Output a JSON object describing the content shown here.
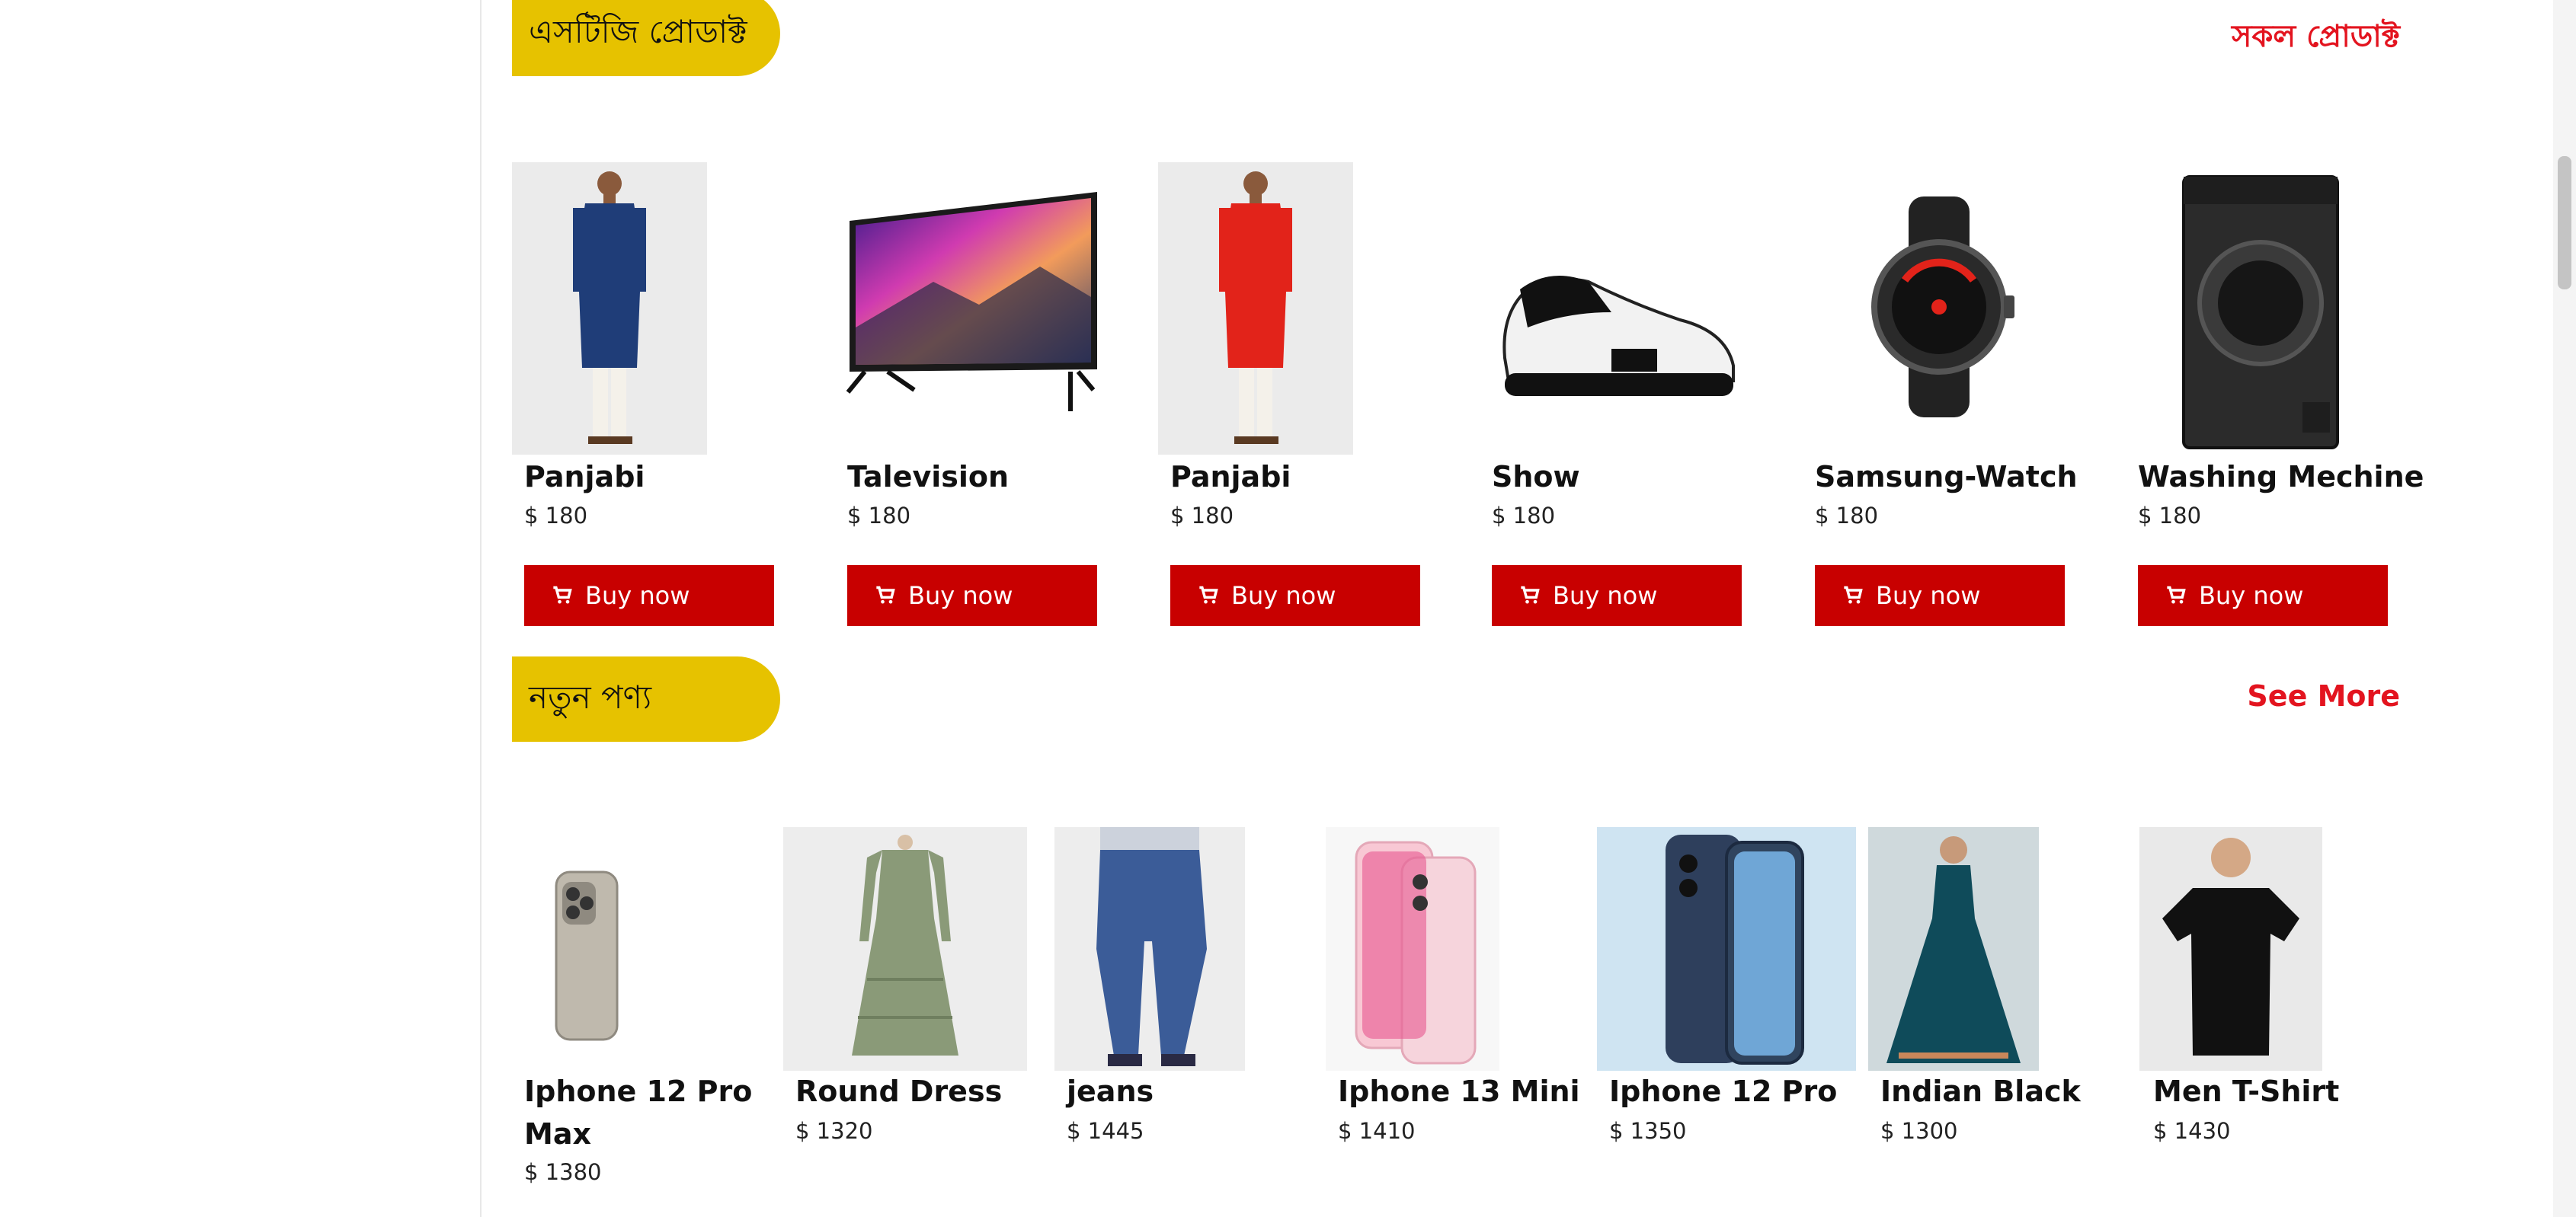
{
  "sections": {
    "stg": {
      "title": "এসটিজি প্রোডাক্ট",
      "link": "সকল প্রোডাক্ট"
    },
    "new": {
      "title": "নতুন পণ্য",
      "link": "See More"
    }
  },
  "currency": "$",
  "buy_label": "Buy now",
  "stg_products": [
    {
      "name": "Panjabi",
      "price": "$ 180",
      "icon": "panjabi-blue"
    },
    {
      "name": "Talevision",
      "price": "$ 180",
      "icon": "television"
    },
    {
      "name": "Panjabi",
      "price": "$ 180",
      "icon": "panjabi-red"
    },
    {
      "name": "Show",
      "price": "$ 180",
      "icon": "sneaker"
    },
    {
      "name": "Samsung-Watch",
      "price": "$ 180",
      "icon": "smartwatch"
    },
    {
      "name": "Washing Mechine",
      "price": "$ 180",
      "icon": "washing-machine"
    }
  ],
  "new_products": [
    {
      "name": "Iphone 12 Pro Max",
      "price": "$ 1380",
      "icon": "iphone-titanium"
    },
    {
      "name": "Round Dress",
      "price": "$ 1320",
      "icon": "dress"
    },
    {
      "name": "jeans",
      "price": "$ 1445",
      "icon": "jeans"
    },
    {
      "name": "Iphone 13 Mini",
      "price": "$ 1410",
      "icon": "iphone-pink"
    },
    {
      "name": "Iphone 12 Pro",
      "price": "$ 1350",
      "icon": "iphone-blue"
    },
    {
      "name": "Indian Black",
      "price": "$ 1300",
      "icon": "gown"
    },
    {
      "name": "Men T-Shirt",
      "price": "$ 1430",
      "icon": "tshirt"
    }
  ],
  "colors": {
    "accent_yellow": "#e6c200",
    "buy_red": "#c80000",
    "link_red": "#e3141f"
  }
}
